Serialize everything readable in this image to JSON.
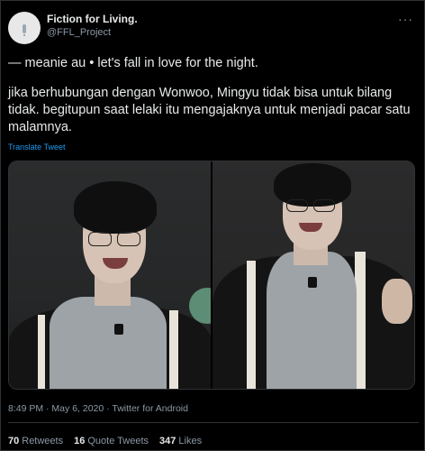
{
  "author": {
    "display_name": "Fiction for Living.",
    "handle": "@FFL_Project"
  },
  "menu_icon": "more-icon",
  "tweet": {
    "line1": "— meanie au • let's fall in love for the night.",
    "line2": "jika berhubungan dengan Wonwoo, Mingyu tidak bisa untuk bilang tidak. begitupun saat lelaki itu mengajaknya untuk menjadi pacar satu malamnya.",
    "translate_label": "Translate Tweet"
  },
  "timestamp": "8:49 PM · May 6, 2020 · Twitter for Android",
  "stats": {
    "retweets_count": "70",
    "retweets_label": "Retweets",
    "quotes_count": "16",
    "quotes_label": "Quote Tweets",
    "likes_count": "347",
    "likes_label": "Likes"
  },
  "colors": {
    "background": "#000000",
    "text": "#e7e9ea",
    "muted": "#8b98a5",
    "link": "#1d9bf0",
    "divider": "#2f3336"
  }
}
